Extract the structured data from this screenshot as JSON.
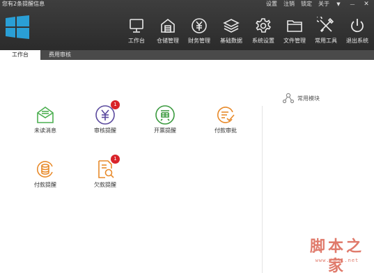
{
  "header": {
    "notice": "您有2条提醒信息",
    "links": [
      "设置",
      "注销",
      "锁定",
      "关于"
    ],
    "window_buttons": {
      "menu": "▼",
      "minimize": "—",
      "close": "✕"
    }
  },
  "nav": [
    {
      "label": "工作台",
      "icon": "monitor-icon"
    },
    {
      "label": "仓储管理",
      "icon": "warehouse-icon"
    },
    {
      "label": "财务管理",
      "icon": "yuan-circle-icon"
    },
    {
      "label": "基础数据",
      "icon": "layers-icon"
    },
    {
      "label": "系统设置",
      "icon": "gear-icon"
    },
    {
      "label": "文件管理",
      "icon": "folder-icon"
    },
    {
      "label": "常用工具",
      "icon": "tools-icon"
    },
    {
      "label": "退出系统",
      "icon": "power-icon"
    }
  ],
  "tabs": [
    {
      "label": "工作台",
      "active": true
    },
    {
      "label": "费用审核",
      "active": false
    }
  ],
  "apps": [
    {
      "label": "未读消息",
      "icon": "envelope-icon",
      "color": "#4caf50",
      "badge": ""
    },
    {
      "label": "审核提醒",
      "icon": "yuan-icon",
      "color": "#5b4a9e",
      "badge": "1"
    },
    {
      "label": "开票提醒",
      "icon": "invoice-icon",
      "color": "#3a9a3e",
      "badge": ""
    },
    {
      "label": "付款审批",
      "icon": "approve-icon",
      "color": "#e88a2a",
      "badge": ""
    },
    {
      "label": "付款提醒",
      "icon": "coins-icon",
      "color": "#e88a2a",
      "badge": ""
    },
    {
      "label": "欠款提醒",
      "icon": "debt-search-icon",
      "color": "#e88a2a",
      "badge": "1"
    }
  ],
  "side": {
    "title": "常用模块",
    "icon": "share-nodes-icon"
  },
  "watermark": {
    "main": "脚本之家",
    "url": "www.jb51.net"
  },
  "colors": {
    "header_bg": "#353535",
    "tabbar_bg": "#4a4a4a",
    "logo": "#2a9fd6",
    "badge": "#d9232a"
  }
}
